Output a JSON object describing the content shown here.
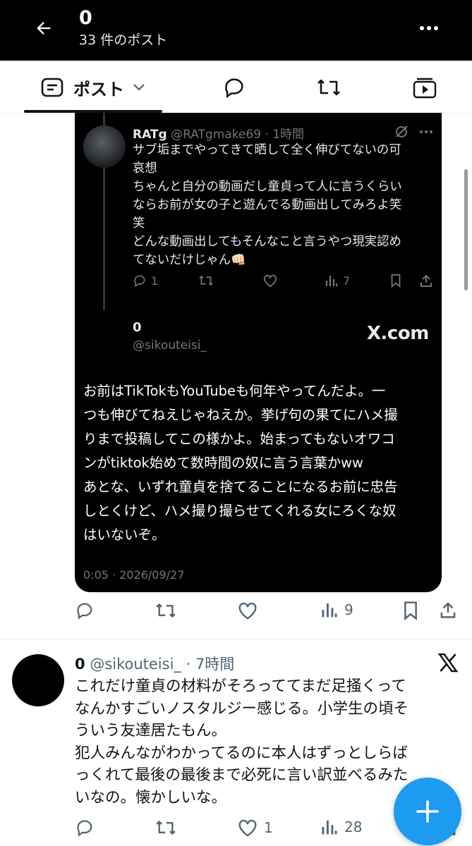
{
  "header": {
    "title": "0",
    "subtitle": "33 件のポスト"
  },
  "tabs": {
    "post_label": "ポスト"
  },
  "quoted_post": {
    "name": "RATg",
    "handle_time": "@RATgmake69 · 1時間",
    "body_lines": [
      "サブ垢までやってきて晒して全く伸びてないの可",
      "哀想",
      "ちゃんと自分の動画だし童貞って人に言うくらい",
      "ならお前が女の子と遊んでる動画出してみろよ笑",
      "笑",
      "どんな動画出してもそんなこと言うやつ現実認め",
      "てないだけじゃん👊🏻"
    ],
    "reply_count": "1",
    "views_count": "7"
  },
  "card_footer": {
    "name": "0",
    "handle": "@sikouteisi_",
    "brand": "X.com"
  },
  "video_caption_lines": [
    "お前はTikTokもYouTubeも何年やってんだよ。一",
    "つも伸びてねえじゃねえか。挙げ句の果てにハメ撮",
    "りまで投稿してこの様かよ。始まってもないオワコ",
    "ンがtiktok始めて数時間の奴に言う言葉かww",
    "あとな、いずれ童貞を捨てることになるお前に忠告",
    "しとくけど、ハメ撮り撮らせてくれる女にろくな奴",
    "はいないぞ。"
  ],
  "video_timestamp": "0:05 · 2026/09/27",
  "main_post_actions": {
    "views_count": "9"
  },
  "reply": {
    "name": "0",
    "handle_time": "@sikouteisi_ · 7時間",
    "body_lines": [
      "これだけ童貞の材料がそろっててまだ足掻くって",
      "なんかすごいノスタルジー感じる。小学生の頃そ",
      "ういう友達居たもん。",
      "犯人みんながわかってるのに本人はずっとしらば",
      "っくれて最後の最後まで必死に言い訳並べるみた",
      "いなの。懐かしいな。"
    ],
    "like_count": "1",
    "views_count": "28"
  },
  "colors": {
    "accent": "#1d9bf0",
    "dark_bg": "#000000",
    "muted": "#536471"
  },
  "icons": [
    "back-arrow-icon",
    "more-icon",
    "post-list-icon",
    "chevron-down-icon",
    "reply-icon",
    "repost-icon",
    "like-icon",
    "views-icon",
    "bookmark-icon",
    "share-icon",
    "video-icon",
    "grok-icon",
    "x-logo-icon",
    "plus-icon"
  ]
}
